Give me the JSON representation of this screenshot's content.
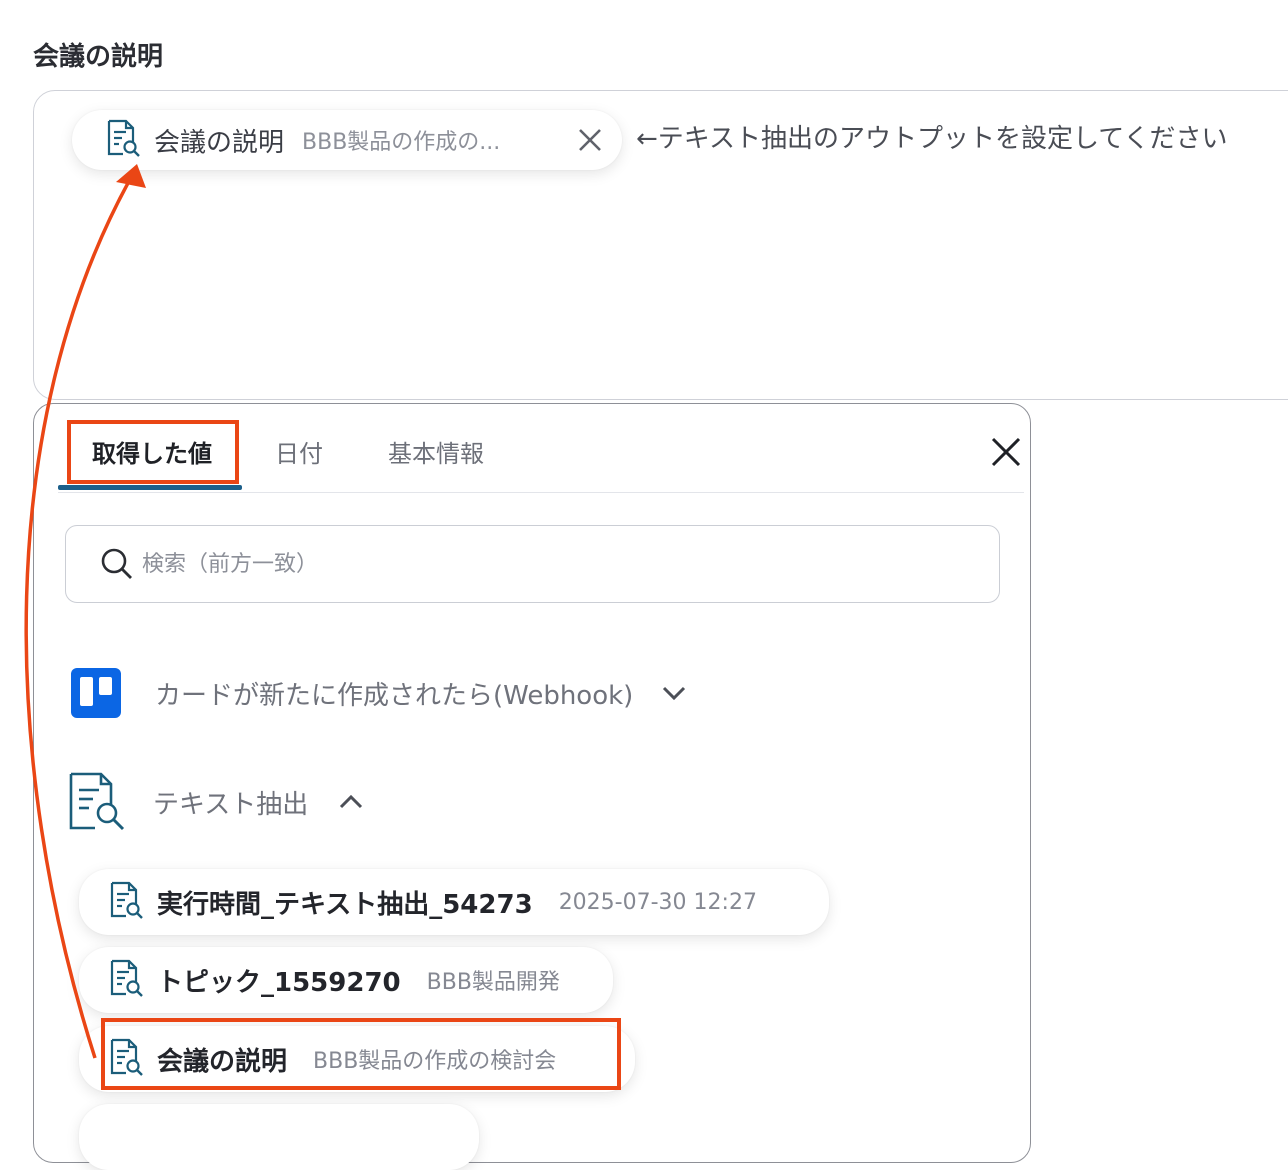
{
  "field": {
    "label": "会議の説明",
    "chip": {
      "name": "会議の説明",
      "value": "BBB製品の作成の...",
      "icon": "document-search-icon"
    },
    "hint": "←テキスト抽出のアウトプットを設定してください"
  },
  "picker": {
    "tabs": [
      {
        "label": "取得した値",
        "active": true
      },
      {
        "label": "日付",
        "active": false
      },
      {
        "label": "基本情報",
        "active": false
      }
    ],
    "search": {
      "placeholder": "検索（前方一致）",
      "value": ""
    },
    "groups": [
      {
        "label": "カードが新たに作成されたら(Webhook)",
        "icon": "trello-icon",
        "expanded": false
      },
      {
        "label": "テキスト抽出",
        "icon": "document-search-icon",
        "expanded": true
      }
    ],
    "items": [
      {
        "name": "実行時間_テキスト抽出_54273",
        "value": "2025-07-30 12:27"
      },
      {
        "name": "トピック_1559270",
        "value": "BBB製品開発"
      },
      {
        "name": "会議の説明",
        "value": "BBB製品の作成の検討会"
      },
      {
        "name": "",
        "value": ""
      }
    ]
  },
  "colors": {
    "highlight": "#ea4615",
    "tab_underline": "#1c5f8a",
    "trello": "#0b66e4",
    "icon_teal": "#1b5d7a"
  }
}
